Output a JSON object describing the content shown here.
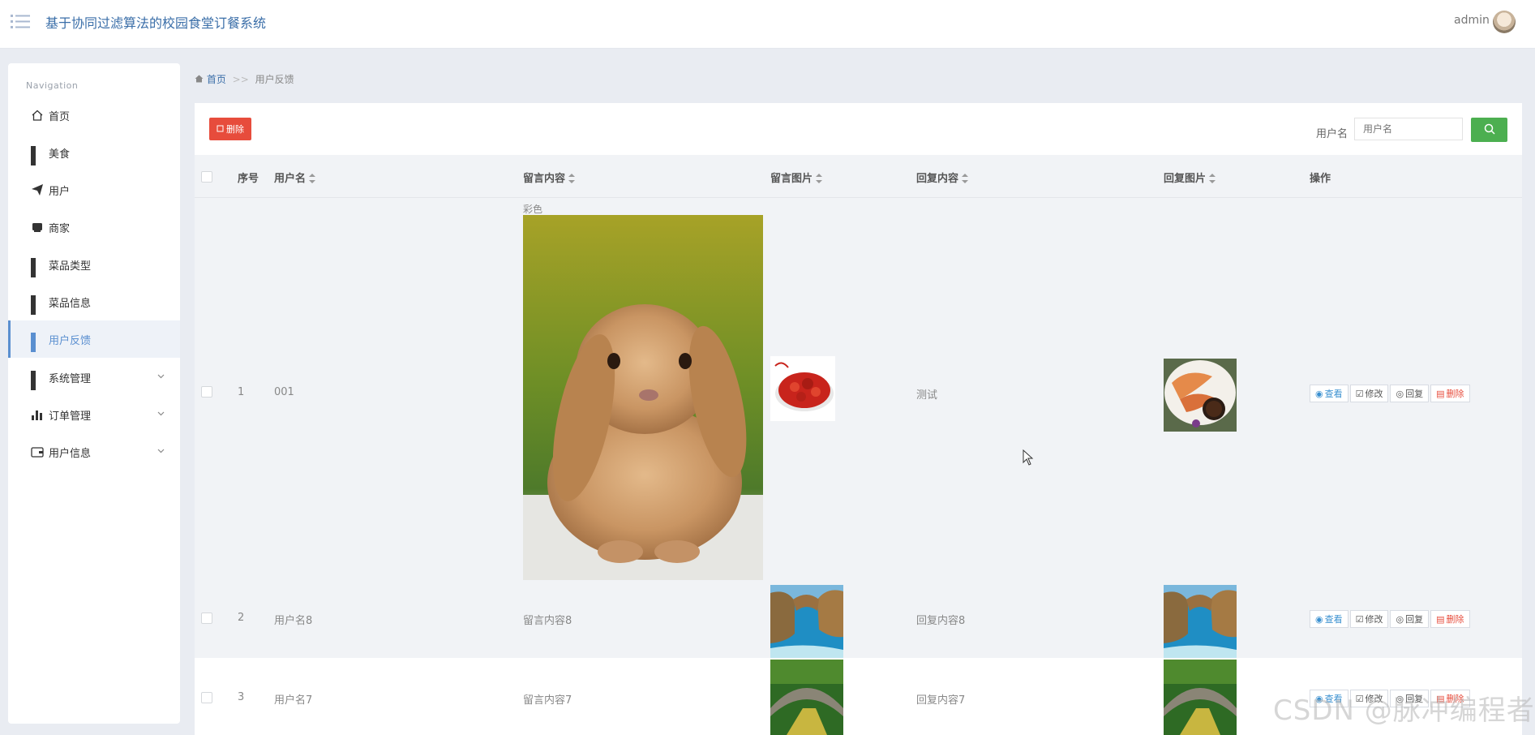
{
  "header": {
    "app_title": "基于协同过滤算法的校园食堂订餐系统",
    "user_name": "admin",
    "menu_icon": "list-menu-icon",
    "avatar_icon": "user-avatar"
  },
  "sidebar": {
    "heading": "Navigation",
    "items": [
      {
        "label": "首页",
        "icon": "home-icon"
      },
      {
        "label": "美食",
        "icon": "grid-icon"
      },
      {
        "label": "用户",
        "icon": "paper-plane-icon"
      },
      {
        "label": "商家",
        "icon": "store-icon"
      },
      {
        "label": "菜品类型",
        "icon": "grid-icon"
      },
      {
        "label": "菜品信息",
        "icon": "grid-icon"
      },
      {
        "label": "用户反馈",
        "icon": "grid-icon",
        "active": true
      },
      {
        "label": "系统管理",
        "icon": "grid-icon",
        "expandable": true
      },
      {
        "label": "订单管理",
        "icon": "bar-chart-icon",
        "expandable": true
      },
      {
        "label": "用户信息",
        "icon": "wallet-icon",
        "expandable": true
      }
    ]
  },
  "breadcrumb": {
    "home": "首页",
    "separator": ">>",
    "current": "用户反馈"
  },
  "toolbar": {
    "delete_label": "删除",
    "search_label": "用户名",
    "search_placeholder": "用户名"
  },
  "table": {
    "columns": [
      "序号",
      "用户名",
      "留言内容",
      "留言图片",
      "回复内容",
      "回复图片",
      "操作"
    ],
    "actions": [
      "查看",
      "修改",
      "回复",
      "删除"
    ],
    "rows": [
      {
        "index": "1",
        "username": "001",
        "content_caption": "彩色",
        "content_image": "rabbit-photo",
        "message_image": "crayfish-photo",
        "reply": "测试",
        "reply_image": "shrimp-dish-photo"
      },
      {
        "index": "2",
        "username": "用户名8",
        "content": "留言内容8",
        "message_image": "sea-arch-photo",
        "reply": "回复内容8",
        "reply_image": "sea-arch-photo"
      },
      {
        "index": "3",
        "username": "用户名7",
        "content": "留言内容7",
        "message_image": "stone-bridge-photo",
        "reply": "回复内容7",
        "reply_image": "stone-bridge-photo"
      }
    ]
  },
  "watermark": "CSDN @脉冲编程者",
  "colors": {
    "accent": "#3a6ea8",
    "delete": "#e74c3c",
    "search": "#4caf50",
    "active_nav": "#5a8fd0"
  }
}
